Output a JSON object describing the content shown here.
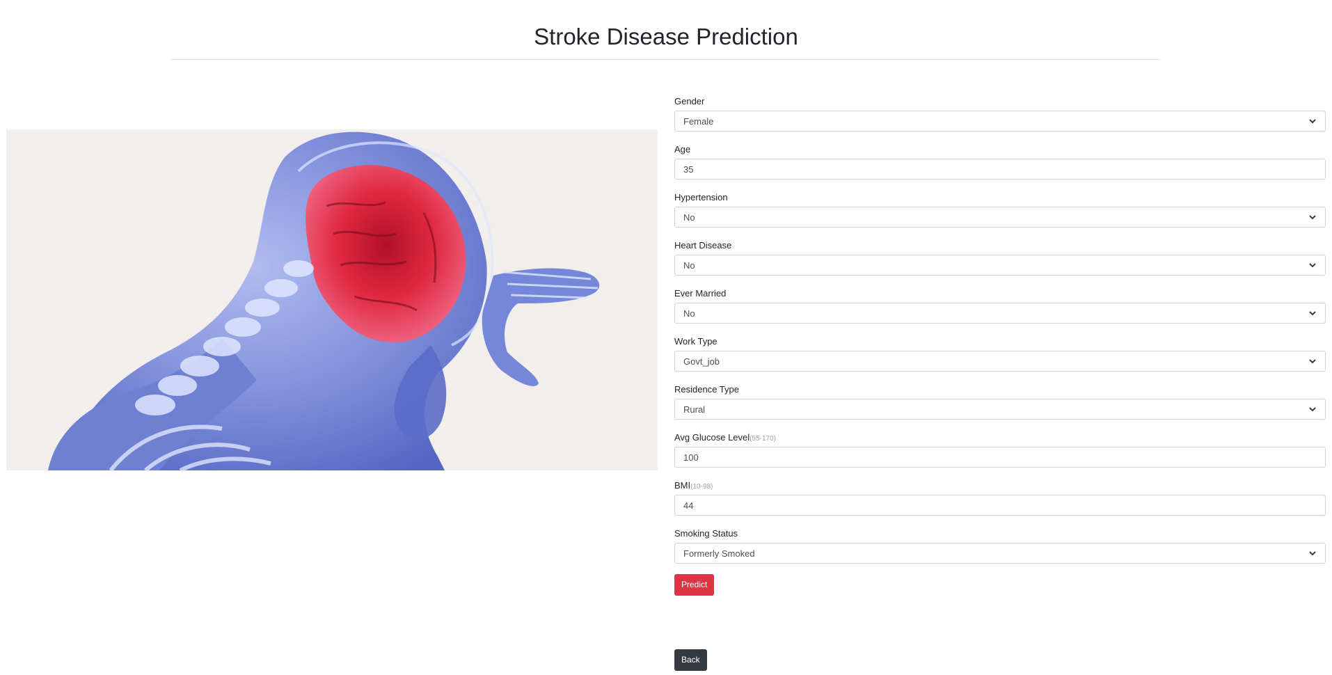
{
  "header": {
    "title": "Stroke Disease Prediction"
  },
  "hero": {
    "image_icon": "brain-skeleton-illustration"
  },
  "form": {
    "fields": [
      {
        "label": "Gender",
        "hint": "",
        "type": "select",
        "value": "Female"
      },
      {
        "label": "Age",
        "hint": "",
        "type": "input",
        "value": "35"
      },
      {
        "label": "Hypertension",
        "hint": "",
        "type": "select",
        "value": "No"
      },
      {
        "label": "Heart Disease",
        "hint": "",
        "type": "select",
        "value": "No"
      },
      {
        "label": "Ever Married",
        "hint": "",
        "type": "select",
        "value": "No"
      },
      {
        "label": "Work Type",
        "hint": "",
        "type": "select",
        "value": "Govt_job"
      },
      {
        "label": "Residence Type",
        "hint": "",
        "type": "select",
        "value": "Rural"
      },
      {
        "label": "Avg Glucose Level",
        "hint": "(55-170)",
        "type": "input",
        "value": "100"
      },
      {
        "label": "BMI",
        "hint": "(10-98)",
        "type": "input",
        "value": "44"
      },
      {
        "label": "Smoking Status",
        "hint": "",
        "type": "select",
        "value": "Formerly Smoked"
      }
    ],
    "predict_label": "Predict",
    "back_label": "Back"
  },
  "colors": {
    "predict": "#dc3545",
    "back": "#343a40",
    "hero_bg": "#f1eeeb"
  }
}
